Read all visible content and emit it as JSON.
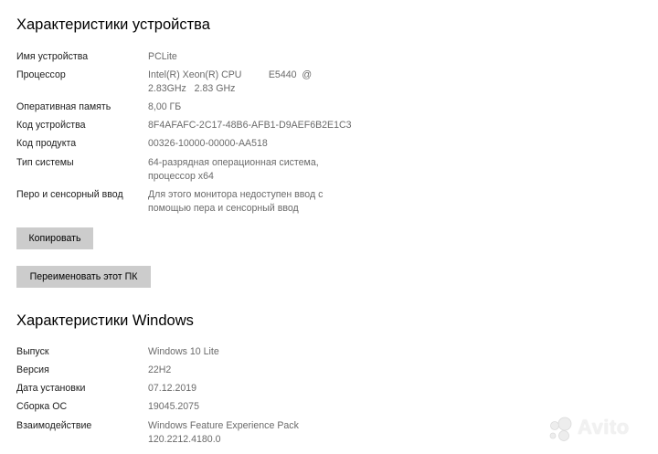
{
  "device_section": {
    "title": "Характеристики устройства",
    "rows": [
      {
        "label": "Имя устройства",
        "value": "PCLite"
      },
      {
        "label": "Процессор",
        "value": "Intel(R) Xeon(R) CPU          E5440  @ 2.83GHz   2.83 GHz"
      },
      {
        "label": "Оперативная память",
        "value": "8,00 ГБ"
      },
      {
        "label": "Код устройства",
        "value": "8F4AFAFC-2C17-48B6-AFB1-D9AEF6B2E1C3"
      },
      {
        "label": "Код продукта",
        "value": "00326-10000-00000-AA518"
      },
      {
        "label": "Тип системы",
        "value": "64-разрядная операционная система, процессор x64"
      },
      {
        "label": "Перо и сенсорный ввод",
        "value": "Для этого монитора недоступен ввод с помощью пера и сенсорный ввод"
      }
    ],
    "copy_button": "Копировать",
    "rename_button": "Переименовать этот ПК"
  },
  "windows_section": {
    "title": "Характеристики Windows",
    "rows": [
      {
        "label": "Выпуск",
        "value": "Windows 10 Lite"
      },
      {
        "label": "Версия",
        "value": "22H2"
      },
      {
        "label": "Дата установки",
        "value": "07.12.2019"
      },
      {
        "label": "Сборка ОС",
        "value": "19045.2075"
      },
      {
        "label": "Взаимодействие",
        "value": "Windows Feature Experience Pack 120.2212.4180.0"
      }
    ]
  },
  "watermark": {
    "text": "Avito",
    "icon": "avito-logo-icon"
  }
}
